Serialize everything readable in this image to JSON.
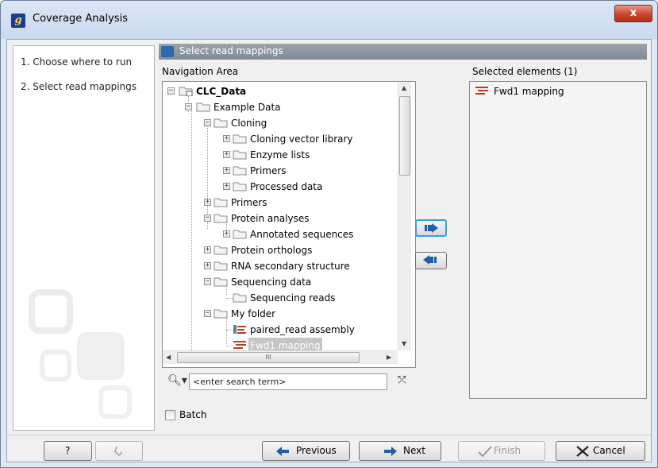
{
  "window": {
    "title": "Coverage Analysis",
    "app_icon_letter": "g",
    "close_label": "x"
  },
  "steps": [
    {
      "label": "1.  Choose where to run"
    },
    {
      "label": "2.  Select read mappings"
    }
  ],
  "section_header": "Select read mappings",
  "navigation": {
    "label": "Navigation Area",
    "tree": [
      {
        "label": "CLC_Data",
        "bold": true,
        "expander": "−"
      },
      {
        "label": "Example Data",
        "expander": "−"
      },
      {
        "label": "Cloning",
        "expander": "−"
      },
      {
        "label": "Cloning vector library",
        "expander": "+"
      },
      {
        "label": "Enzyme lists",
        "expander": "+"
      },
      {
        "label": "Primers",
        "expander": "+"
      },
      {
        "label": "Processed data",
        "expander": "+"
      },
      {
        "label": "Primers",
        "expander": "+"
      },
      {
        "label": "Protein analyses",
        "expander": "−"
      },
      {
        "label": "Annotated sequences",
        "expander": "+"
      },
      {
        "label": "Protein orthologs",
        "expander": "+"
      },
      {
        "label": "RNA secondary structure",
        "expander": "+"
      },
      {
        "label": "Sequencing data",
        "expander": "−"
      },
      {
        "label": "Sequencing reads",
        "expander": ""
      },
      {
        "label": "My folder",
        "expander": "−"
      },
      {
        "label": "paired_read assembly",
        "expander": "",
        "icon": "assembly"
      },
      {
        "label": "Fwd1 mapping",
        "expander": "",
        "icon": "mapping",
        "selected": true
      }
    ],
    "search_placeholder": "<enter search term>",
    "search_value": "",
    "hscroll_grip": "III"
  },
  "selected": {
    "label": "Selected elements (1)",
    "items": [
      {
        "label": "Fwd1 mapping"
      }
    ]
  },
  "batch_label": "Batch",
  "buttons": {
    "help": "?",
    "previous": "Previous",
    "next": "Next",
    "finish": "Finish",
    "cancel": "Cancel"
  },
  "colors": {
    "accent": "#3c9ed9",
    "header_bg": "#818b96",
    "mapping_red": "#c0392b"
  }
}
